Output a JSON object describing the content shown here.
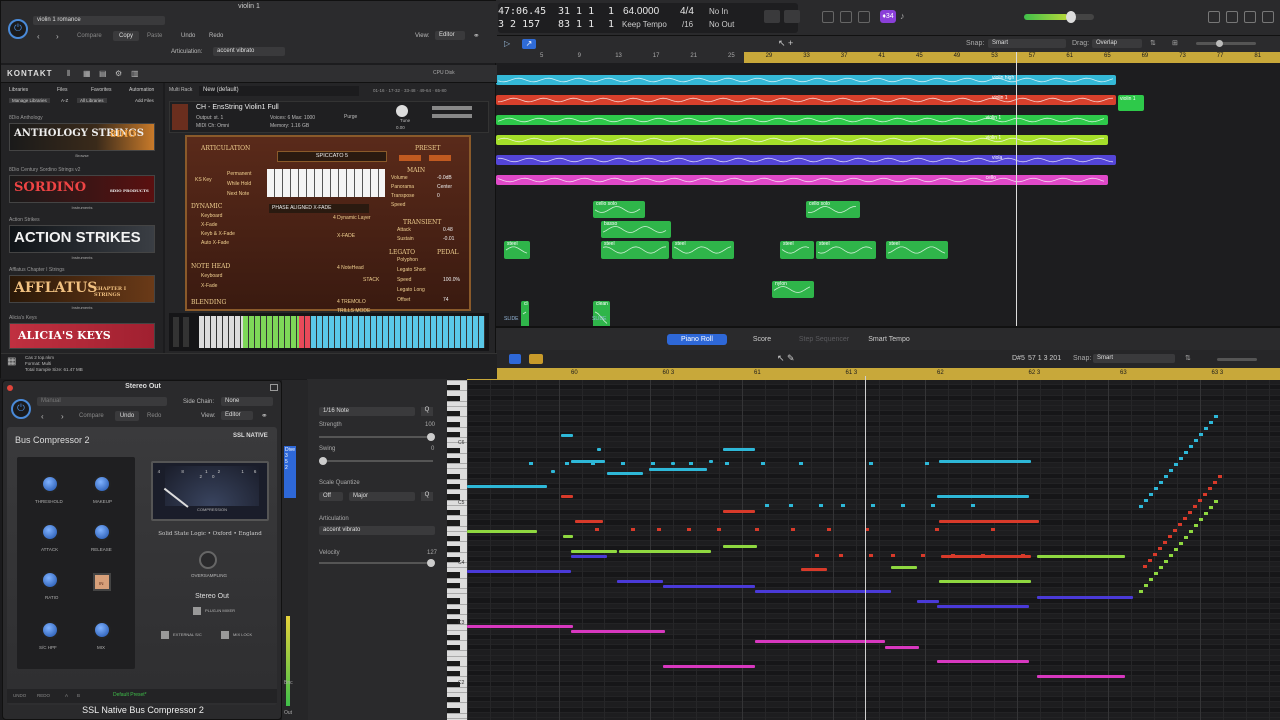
{
  "plugin_window": {
    "title": "violin 1",
    "preset": "violin 1 romance",
    "compare": "Compare",
    "copy": "Copy",
    "paste": "Paste",
    "undo": "Undo",
    "redo": "Redo",
    "view_label": "View:",
    "view_value": "Editor",
    "articulation_label": "Articulation:",
    "articulation_value": "accent vibrato"
  },
  "kontakt": {
    "logo": "KONTAKT",
    "tabs": [
      "Libraries",
      "Files",
      "Favorites",
      "Automation"
    ],
    "tab_buttons": [
      "Manage Libraries",
      "A-Z",
      "All Libraries",
      "Add Files"
    ],
    "multi_rack": "Multi Rack",
    "multi_name": "New (default)",
    "cpu_disk": "CPU  Disk",
    "libraries": [
      {
        "section": "8Dio Anthology",
        "name": "ANTHOLOGY STRINGS",
        "badge": "8DIO",
        "sub": "Browse"
      },
      {
        "section": "8Dio Century Sordino Strings v2",
        "name": "SORDINO",
        "badge": "8DIO PRODUCTS",
        "sub": "Instruments"
      },
      {
        "section": "Action Strikes",
        "name": "ACTION STRIKES",
        "badge": "",
        "sub": "Instruments"
      },
      {
        "section": "Afflatus Chapter I Strings",
        "name": "AFFLATUS",
        "badge": "CHAPTER I STRINGS",
        "sub": "Instruments"
      },
      {
        "section": "Alicia's Keys",
        "name": "ALICIA'S KEYS",
        "badge": "",
        "sub": ""
      }
    ],
    "instrument": {
      "name": "CH - EnsString Violin1 Full",
      "output": "st. 1",
      "midi": "Omni",
      "voices": "6",
      "max": "1000",
      "memory": "1.16 GB",
      "purge": "Purge",
      "tune": "Tune",
      "tune_val": "0.00"
    },
    "articulation_title": "ARTICULATION",
    "articulation_value": "SPICCATO 5",
    "preset_title": "PRESET",
    "ks_key": "KS Key",
    "options": [
      "Permanent",
      "While Hold",
      "Next Note"
    ],
    "main_title": "MAIN",
    "main_rows": [
      {
        "k": "Volume",
        "v": "-0.0dB"
      },
      {
        "k": "Panorama",
        "v": "Center"
      },
      {
        "k": "Transpose",
        "v": "0"
      },
      {
        "k": "Speed",
        "v": ""
      }
    ],
    "dynamic_title": "DYNAMIC",
    "dynamic_mode": "PHASE ALIGNED X-FADE",
    "dynamic_rows": [
      "Keyboard",
      "X-Fade",
      "Keyb & X-Fade",
      "Auto X-Fade"
    ],
    "dynamic_layer": "4 Dynamic Layer",
    "xfade_label": "X-FADE",
    "transient_title": "TRANSIENT",
    "transient_rows": [
      {
        "k": "Attack",
        "v": "0.48"
      },
      {
        "k": "Sustain",
        "v": "-0.01"
      }
    ],
    "legato_title": "LEGATO",
    "pedal_title": "PEDAL",
    "legato_rows": [
      "Polyphon",
      "Legato Short",
      "Speed",
      "Legato Long",
      "Offset"
    ],
    "legato_values": [
      "",
      "",
      "100.0%",
      "",
      "74"
    ],
    "note_head_title": "NOTE HEAD",
    "note_head_rows": [
      "Keyboard",
      "X-Fade"
    ],
    "note_head_right": "4 NoteHead",
    "stack": "STACK",
    "blending_title": "BLENDING",
    "tremolo": "4 TREMOLO",
    "trills": "TRILLS MODE",
    "info": [
      "Cas 2 top.nkm",
      "Format: Multi",
      "Total Sample Size: 61.47 MB"
    ]
  },
  "ssl": {
    "window_title": "Stereo Out",
    "preset": "Manual",
    "side_chain_label": "Side Chain:",
    "side_chain_value": "None",
    "compare": "Compare",
    "undo": "Undo",
    "redo": "Redo",
    "view_label": "View:",
    "view_value": "Editor",
    "plugin_name": "Bus Compressor 2",
    "brand": "SSL NATIVE",
    "knobs": [
      "THRESHOLD",
      "MAKEUP",
      "ATTACK",
      "RELEASE",
      "RATIO",
      "IN",
      "S/C HPF",
      "MIX"
    ],
    "meter_label": "COMPRESSION",
    "meter_scale": [
      "4",
      "8",
      "12",
      "16",
      "20"
    ],
    "brand_line": "Solid State Logic • Oxford • England",
    "oversampling": "OVERSAMPLING",
    "oversampling_vals": [
      "OFF",
      "2X",
      "4X"
    ],
    "track": "Stereo Out",
    "plug_in_mixer": "PLUG-IN MIXER",
    "external_sc": "EXTERNAL S/C",
    "mix_lock": "MIX LOCK",
    "footer_preset": "Default Preset*",
    "footer_left": [
      "UNDO",
      "REDO",
      "A",
      "B"
    ],
    "footer_title": "SSL Native Bus Compressor 2"
  },
  "lcd": {
    "time": "47:06.45",
    "time2": "3 2 157",
    "bars": "31 1 1",
    "bars2": "83 1 1",
    "beat": "1",
    "beat2": "1",
    "tempo": "64.0000",
    "tempo_mode": "Keep Tempo",
    "sig": "4/4",
    "division": "/16",
    "in": "No In",
    "out": "No Out",
    "badge": "♦34"
  },
  "tracks_area": {
    "snap_label": "Snap:",
    "snap_value": "Smart",
    "drag_label": "Drag:",
    "drag_value": "Overlap",
    "ruler": [
      "5",
      "9",
      "13",
      "17",
      "21",
      "25",
      "29",
      "33",
      "37",
      "41",
      "45",
      "49",
      "53",
      "57",
      "61",
      "65",
      "69",
      "73",
      "77",
      "81",
      "85"
    ],
    "regions": [
      {
        "label": "violin high",
        "color": "#34b8d6"
      },
      {
        "label": "violin 1",
        "color": "#d8402c"
      },
      {
        "label": "violin 1",
        "color": "#2ec94a"
      },
      {
        "label": "violin 1",
        "color": "#a5df2a"
      },
      {
        "label": "viola",
        "color": "#5445d8"
      },
      {
        "label": "cello",
        "color": "#e049c8"
      },
      {
        "label": "cello solo",
        "color": "#2fb54a"
      },
      {
        "label": "cello solo",
        "color": "#2fb54a"
      },
      {
        "label": "basso",
        "color": "#2fb54a"
      },
      {
        "label": "steel",
        "color": "#2fb54a"
      },
      {
        "label": "steel",
        "color": "#2fb54a"
      },
      {
        "label": "steel",
        "color": "#2fb54a"
      },
      {
        "label": "steel",
        "color": "#2fb54a"
      },
      {
        "label": "steel",
        "color": "#2fb54a"
      },
      {
        "label": "steel",
        "color": "#2fb54a"
      },
      {
        "label": "nylon",
        "color": "#2fb54a"
      },
      {
        "label": "cl",
        "color": "#2fb54a"
      },
      {
        "label": "clean",
        "color": "#2fb54a"
      }
    ],
    "slide": "SLIDE",
    "violin1_end": "violin 1"
  },
  "piano_roll": {
    "tabs": [
      "Piano Roll",
      "Score",
      "Step Sequencer",
      "Smart Tempo"
    ],
    "position": "57 1 3 201",
    "note_name": "D#5",
    "snap_label": "Snap:",
    "snap_value": "Smart",
    "ruler": [
      "60",
      "60 3",
      "61",
      "61 3",
      "62",
      "62 3",
      "63",
      "63 3"
    ],
    "octaves": [
      "C6",
      "C5",
      "C4",
      "C3",
      "C2"
    ],
    "time_quantize": "1/16 Note",
    "strength_label": "Strength",
    "strength_value": "100",
    "swing_label": "Swing",
    "swing_value": "0",
    "scale_quantize_label": "Scale Quantize",
    "scale_off": "Off",
    "scale_value": "Major",
    "articulation_label": "Articulation",
    "articulation_value": "accent vibrato",
    "velocity_label": "Velocity",
    "velocity_value": "127"
  },
  "mixer_strip": {
    "labels": [
      "Dive",
      "3",
      "5",
      "2",
      "Bnc",
      "Out"
    ]
  },
  "colors": {
    "ruler": "#c8a83a",
    "cyan": "#2eb8d8",
    "red": "#d83a2a",
    "green": "#8fd840",
    "lime": "#a8e03a",
    "blue": "#4a3ad8",
    "magenta": "#d838c0"
  }
}
